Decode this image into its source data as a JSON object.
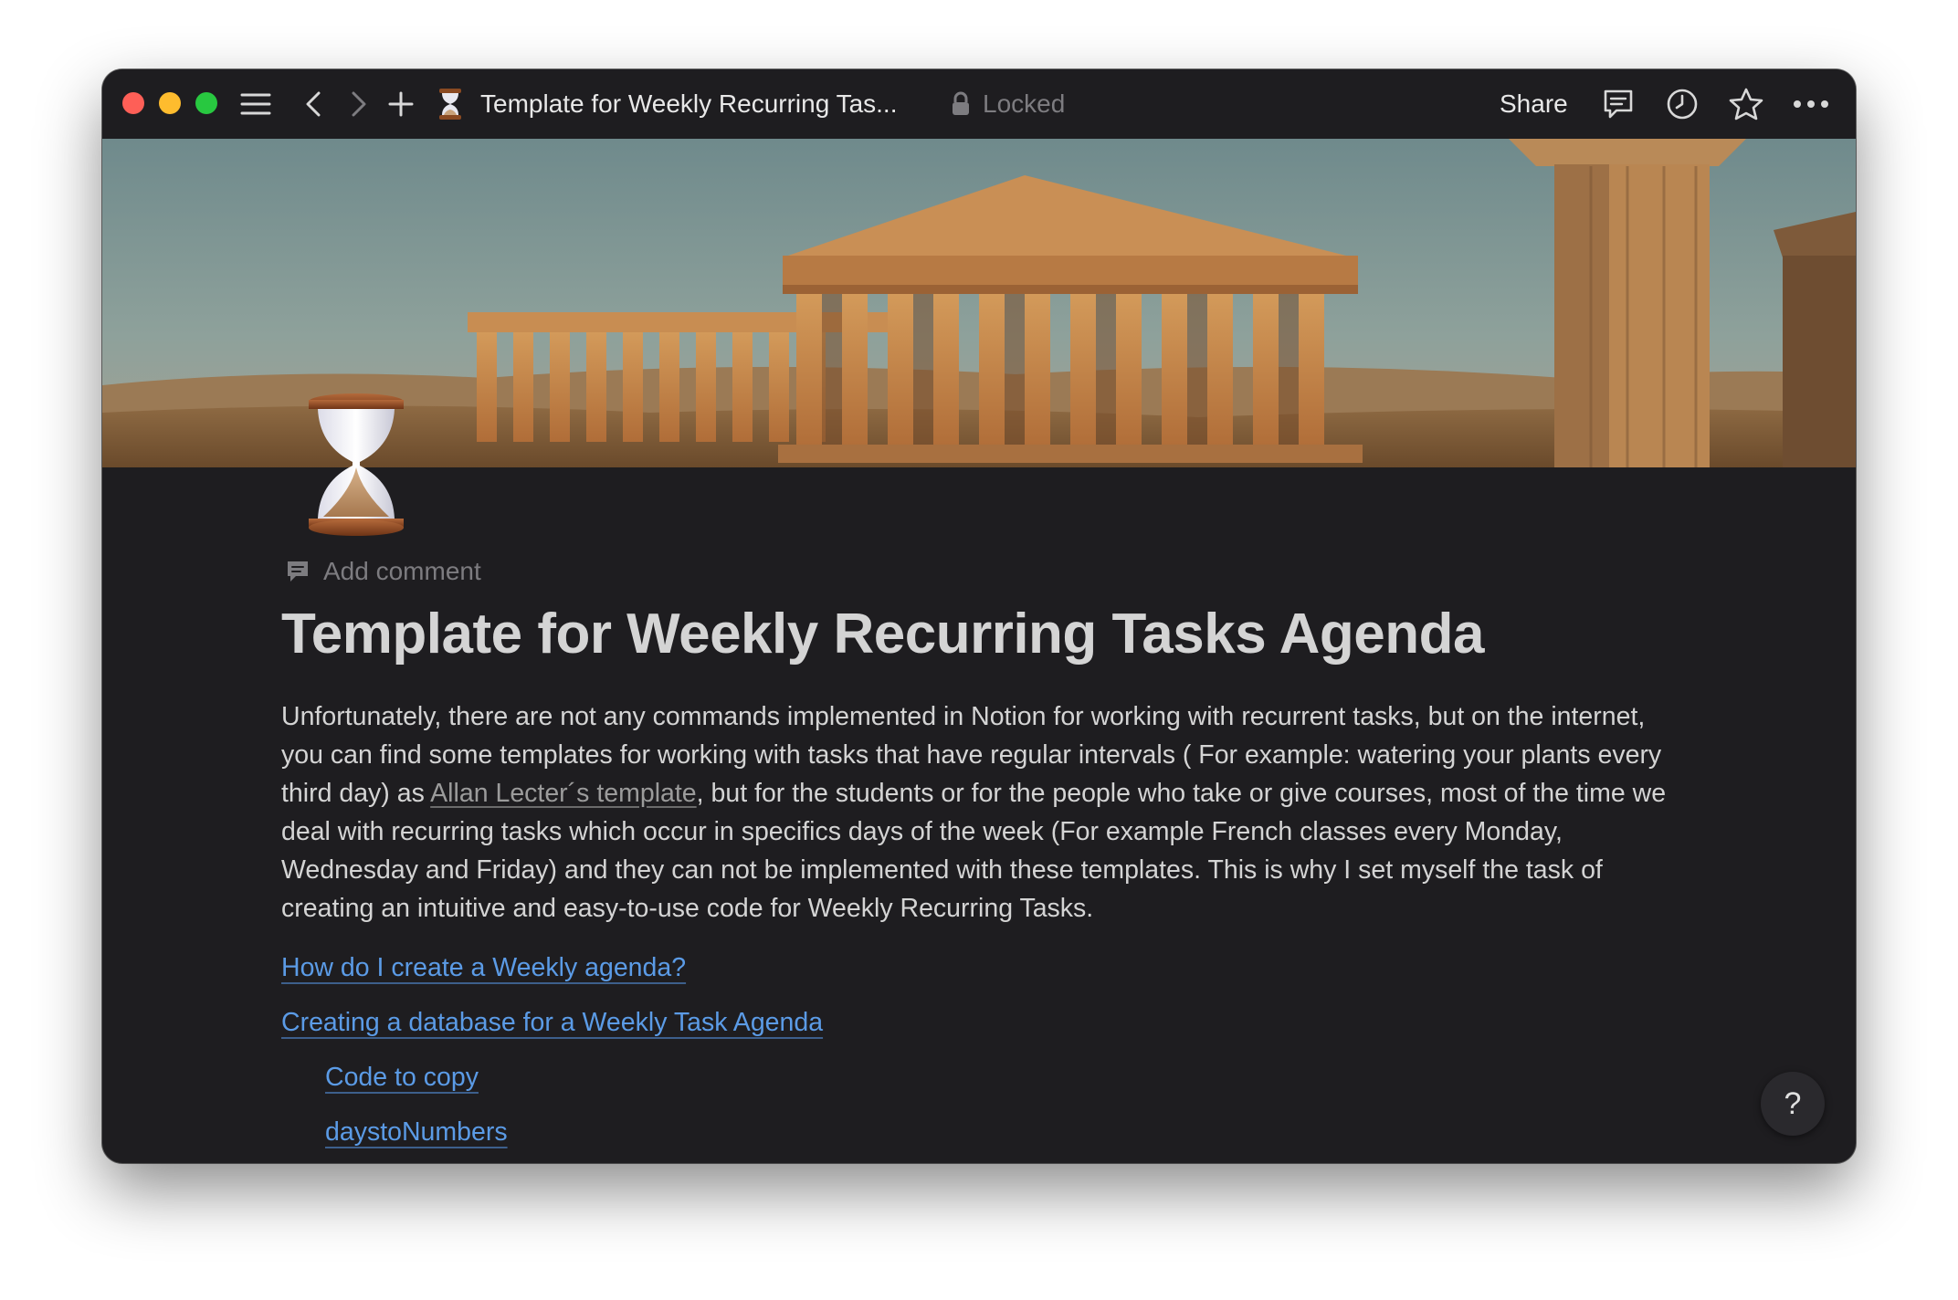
{
  "titlebar": {
    "page_title": "Template for Weekly Recurring Tas...",
    "lock_status": "Locked",
    "share_label": "Share",
    "icons": [
      "sidebar-menu-icon",
      "back-arrow-icon",
      "forward-arrow-icon",
      "plus-icon",
      "hourglass-icon",
      "lock-icon",
      "comment-icon",
      "clock-icon",
      "star-icon",
      "more-icon"
    ]
  },
  "page": {
    "icon": "hourglass",
    "add_comment_label": "Add comment",
    "title": "Template for Weekly Recurring Tasks Agenda",
    "intro": {
      "before_link": "Unfortunately, there are not any commands implemented in Notion for working with recurrent tasks, but on the internet, you can find some templates for working with tasks that have regular intervals ( For example: watering your plants every third day) as ",
      "link_text": "Allan Lecter´s template",
      "after_link": ", but for the students or for the people who take or give courses, most of the time we deal with recurring tasks which occur in specifics days of the week (For example French classes every Monday, Wednesday and Friday) and they can not be implemented with these templates. This is why I set myself the task of creating an intuitive and easy-to-use code for Weekly Recurring Tasks."
    },
    "toc": [
      {
        "label": "How do I create a Weekly agenda?",
        "level": 0
      },
      {
        "label": "Creating a database for a Weekly Task Agenda",
        "level": 0
      },
      {
        "label": "Code to copy",
        "level": 1
      },
      {
        "label": "daystoNumbers",
        "level": 1
      }
    ]
  },
  "help_label": "?",
  "colors": {
    "background": "#1e1d20",
    "text": "#d4d4d4",
    "link": "#5b9be6",
    "muted": "#7d7c80"
  }
}
